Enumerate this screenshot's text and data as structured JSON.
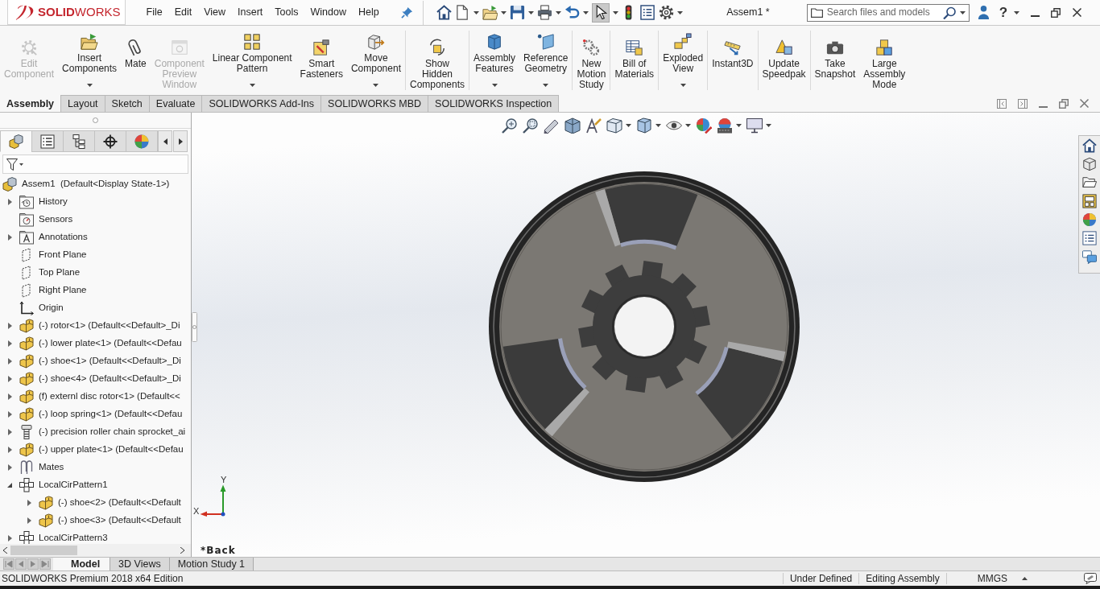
{
  "title_bar": {
    "logo": "**SOLID**WORKS",
    "menus": [
      "File",
      "Edit",
      "View",
      "Insert",
      "Tools",
      "Window",
      "Help"
    ],
    "select_active": true,
    "document_title": "Assem1 *",
    "search": {
      "placeholder": "Search files and models"
    },
    "help": "?"
  },
  "ribbon": {
    "groups": [
      {
        "buttons": [
          {
            "label": "Edit\nComponent",
            "disabled": true,
            "dropdown": false
          },
          {
            "label": "Insert\nComponents",
            "disabled": false,
            "dropdown": true
          },
          {
            "label": "Mate",
            "disabled": false,
            "dropdown": false
          },
          {
            "label": "Component\nPreview\nWindow",
            "disabled": true,
            "dropdown": false
          },
          {
            "label": "Linear Component\nPattern",
            "disabled": false,
            "dropdown": true
          },
          {
            "label": "Smart\nFasteners",
            "disabled": false,
            "dropdown": false
          },
          {
            "label": "Move\nComponent",
            "disabled": false,
            "dropdown": true
          }
        ]
      },
      {
        "buttons": [
          {
            "label": "Show\nHidden\nComponents",
            "disabled": false,
            "dropdown": false
          }
        ]
      },
      {
        "buttons": [
          {
            "label": "Assembly\nFeatures",
            "disabled": false,
            "dropdown": true
          },
          {
            "label": "Reference\nGeometry",
            "disabled": false,
            "dropdown": true
          }
        ]
      },
      {
        "buttons": [
          {
            "label": "New\nMotion\nStudy",
            "disabled": false,
            "dropdown": false
          }
        ]
      },
      {
        "buttons": [
          {
            "label": "Bill of\nMaterials",
            "disabled": false,
            "dropdown": false
          }
        ]
      },
      {
        "buttons": [
          {
            "label": "Exploded\nView",
            "disabled": false,
            "dropdown": true
          }
        ]
      },
      {
        "buttons": [
          {
            "label": "Instant3D",
            "disabled": false,
            "dropdown": false
          }
        ]
      },
      {
        "buttons": [
          {
            "label": "Update\nSpeedpak",
            "disabled": false,
            "dropdown": false
          }
        ]
      },
      {
        "buttons": [
          {
            "label": "Take\nSnapshot",
            "disabled": false,
            "dropdown": false
          },
          {
            "label": "Large\nAssembly\nMode",
            "disabled": false,
            "dropdown": false
          }
        ]
      }
    ]
  },
  "command_tabs": [
    {
      "label": "Assembly",
      "selected": true
    },
    {
      "label": "Layout",
      "selected": false
    },
    {
      "label": "Sketch",
      "selected": false
    },
    {
      "label": "Evaluate",
      "selected": false
    },
    {
      "label": "SOLIDWORKS Add-Ins",
      "selected": false
    },
    {
      "label": "SOLIDWORKS MBD",
      "selected": false
    },
    {
      "label": "SOLIDWORKS Inspection",
      "selected": false
    }
  ],
  "feature_manager": {
    "panel_tabs": [
      {
        "selected": true
      },
      {
        "selected": false
      },
      {
        "selected": false
      },
      {
        "selected": false
      },
      {
        "selected": false
      }
    ],
    "tree": [
      {
        "label": "Assem1  (Default<Display State-1>)",
        "kind": "assembly",
        "children": [
          {
            "label": "History",
            "kind": "history",
            "expanded": false
          },
          {
            "label": "Sensors",
            "kind": "sensors"
          },
          {
            "label": "Annotations",
            "kind": "annotations",
            "expanded": false
          },
          {
            "label": "Front Plane",
            "kind": "plane"
          },
          {
            "label": "Top Plane",
            "kind": "plane"
          },
          {
            "label": "Right Plane",
            "kind": "plane"
          },
          {
            "label": "Origin",
            "kind": "origin"
          },
          {
            "label": "(-) rotor<1> (Default<<Default>_Di",
            "kind": "part",
            "expanded": false
          },
          {
            "label": "(-) lower plate<1> (Default<<Defau",
            "kind": "part",
            "expanded": false
          },
          {
            "label": "(-) shoe<1> (Default<<Default>_Di",
            "kind": "part",
            "expanded": false
          },
          {
            "label": "(-) shoe<4> (Default<<Default>_Di",
            "kind": "part",
            "expanded": false
          },
          {
            "label": "(f) externl disc rotor<1> (Default<<",
            "kind": "part",
            "expanded": false
          },
          {
            "label": "(-) loop spring<1> (Default<<Defau",
            "kind": "part",
            "expanded": false
          },
          {
            "label": "(-) precision roller chain sprocket_ai",
            "kind": "toolbox_part",
            "expanded": false
          },
          {
            "label": "(-) upper plate<1> (Default<<Defau",
            "kind": "part",
            "expanded": false
          },
          {
            "label": "Mates",
            "kind": "mates",
            "expanded": false
          },
          {
            "label": "LocalCirPattern1",
            "kind": "pattern",
            "expanded": true,
            "children": [
              {
                "label": "(-) shoe<2> (Default<<Default",
                "kind": "part",
                "expanded": false
              },
              {
                "label": "(-) shoe<3> (Default<<Default",
                "kind": "part",
                "expanded": false
              }
            ]
          },
          {
            "label": "LocalCirPattern3",
            "kind": "pattern",
            "expanded": false
          }
        ]
      }
    ]
  },
  "viewport": {
    "view_name": "*Back",
    "triad": {
      "x_label": "X",
      "y_label": "Y"
    }
  },
  "bottom_tabs": [
    {
      "label": "Model",
      "selected": true
    },
    {
      "label": "3D Views",
      "selected": false
    },
    {
      "label": "Motion Study 1",
      "selected": false
    }
  ],
  "status_bar": {
    "product": "SOLIDWORKS Premium 2018 x64 Edition",
    "fields": [
      "Under Defined",
      "Editing Assembly",
      "MMGS"
    ]
  }
}
